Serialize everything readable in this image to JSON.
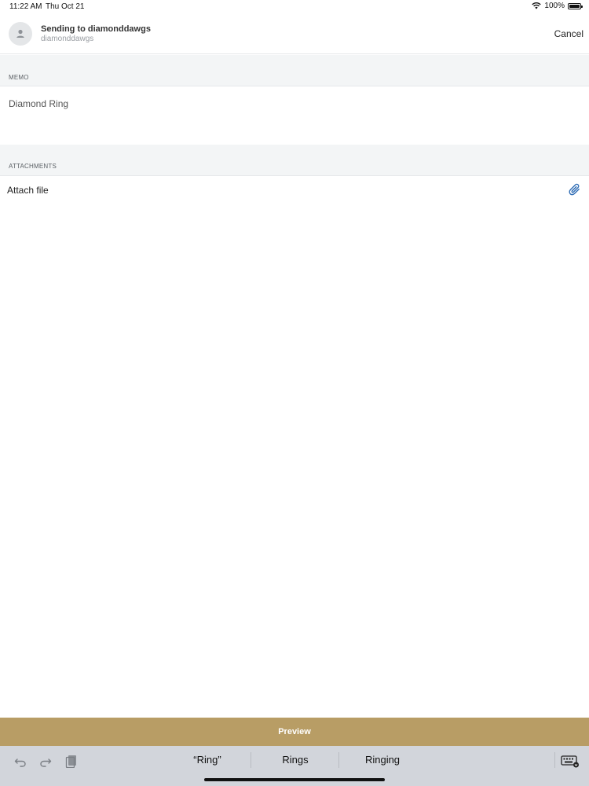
{
  "status_bar": {
    "time": "11:22 AM",
    "date": "Thu Oct 21",
    "battery": "100%"
  },
  "header": {
    "title": "Sending to diamonddawgs",
    "subtitle": "diamonddawgs",
    "cancel_label": "Cancel"
  },
  "memo": {
    "section_label": "MEMO",
    "value": "Diamond Ring"
  },
  "attachments": {
    "section_label": "ATTACHMENTS",
    "attach_label": "Attach file"
  },
  "preview": {
    "label": "Preview"
  },
  "keyboard": {
    "suggestions": [
      "“Ring”",
      "Rings",
      "Ringing"
    ]
  },
  "colors": {
    "accent": "#b89d65",
    "link_icon": "#2f6db5"
  }
}
